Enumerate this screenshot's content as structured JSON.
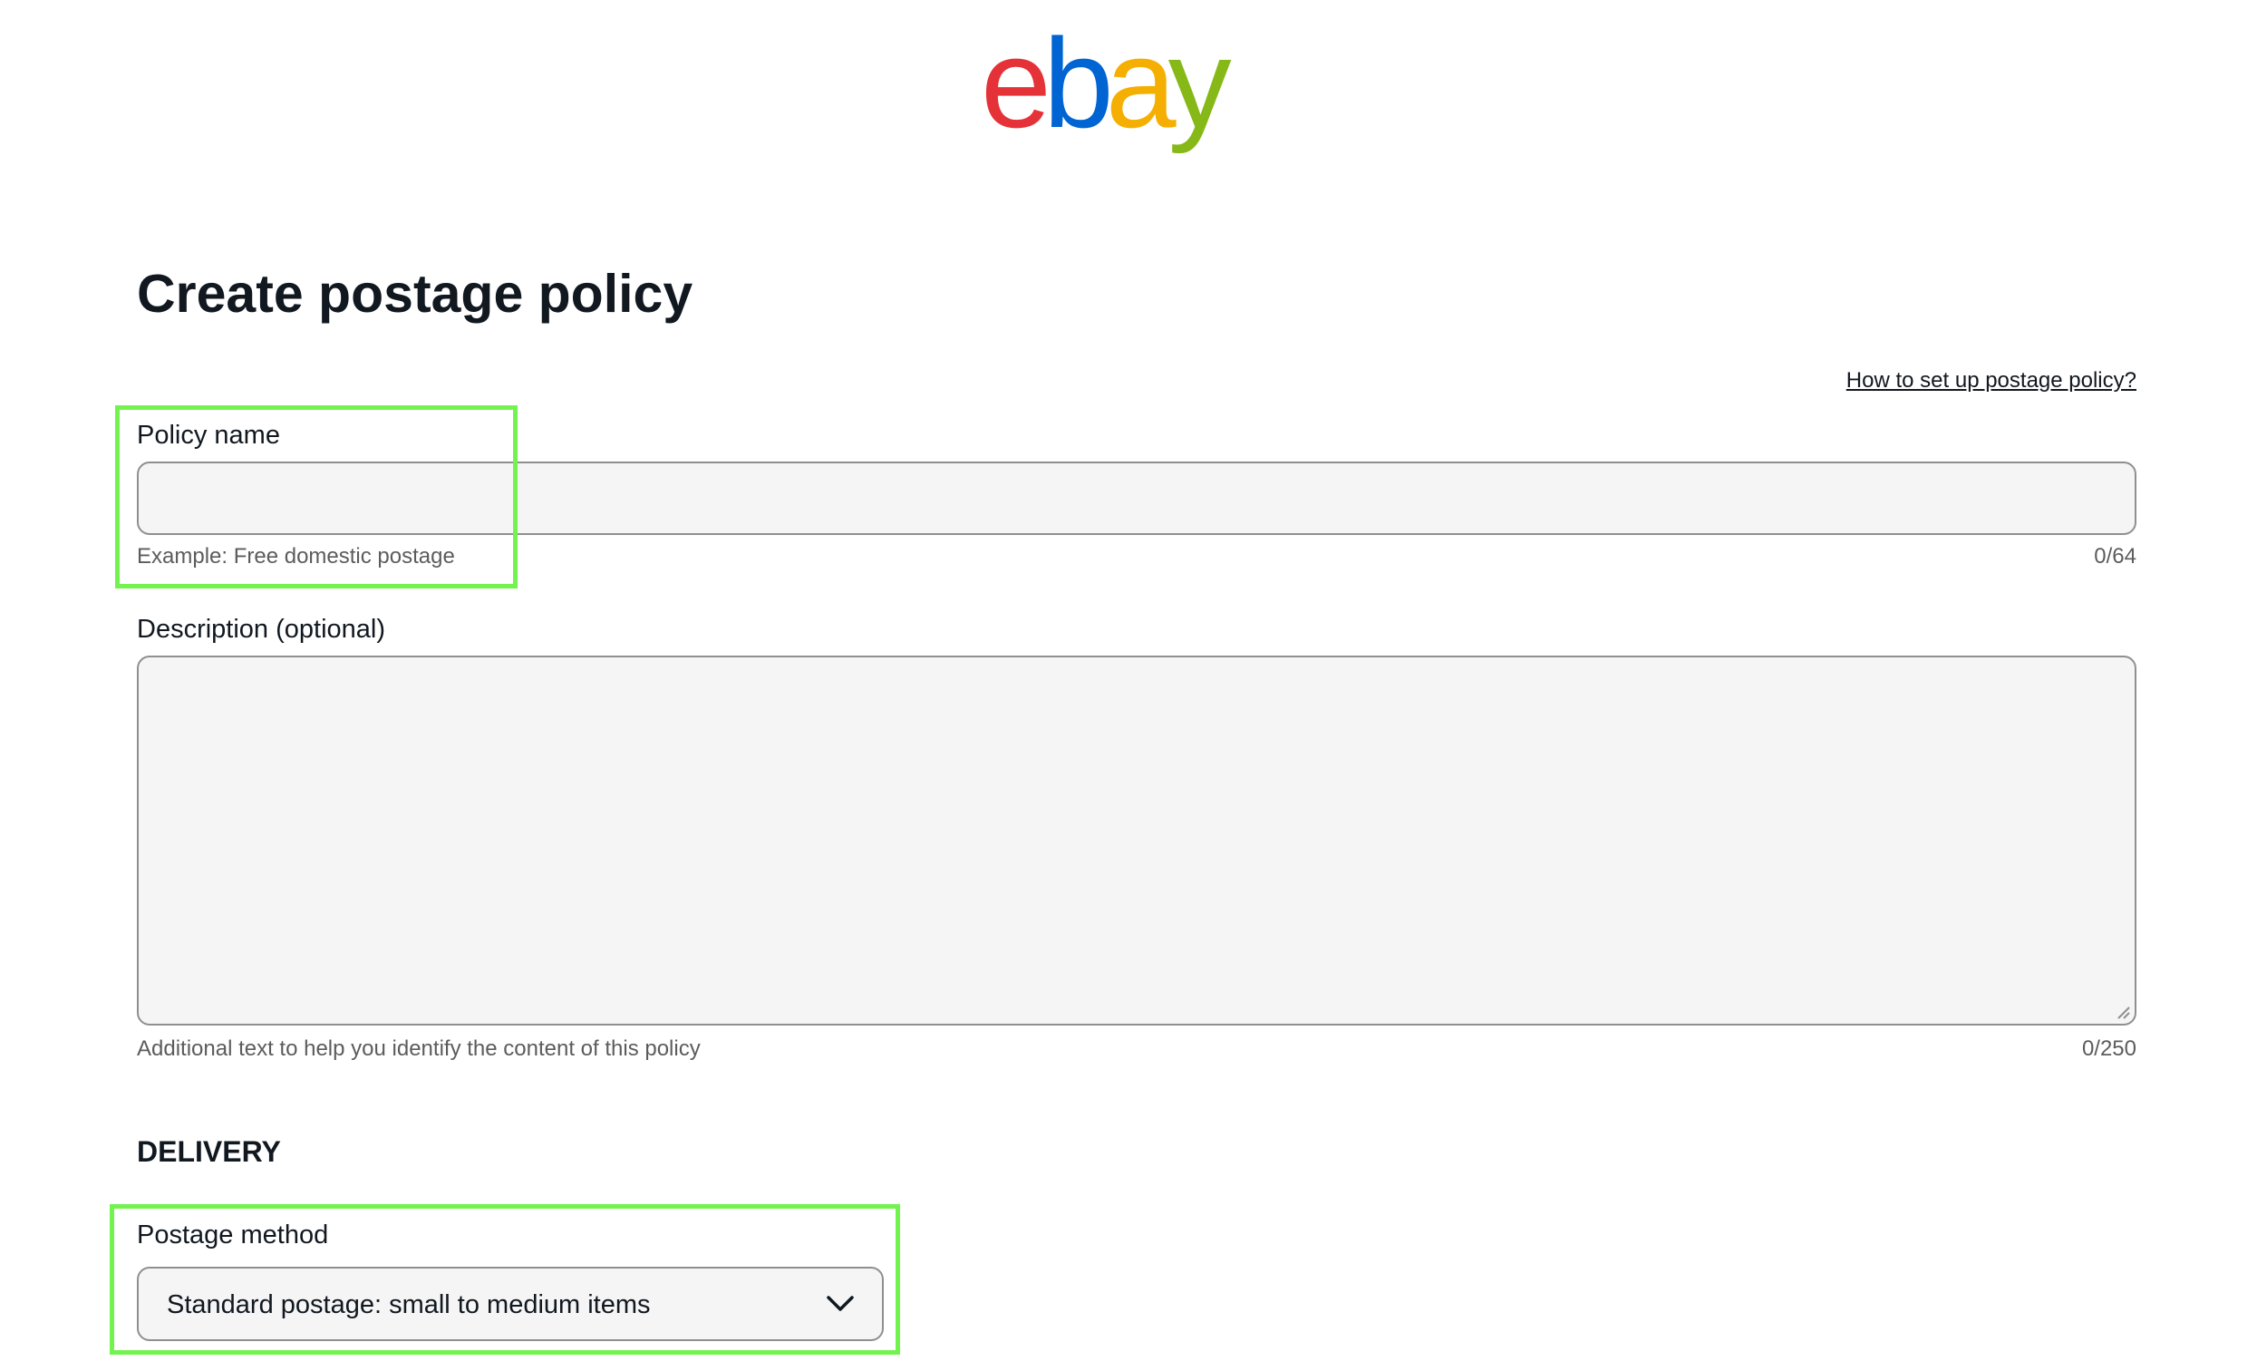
{
  "brand": {
    "logo_letters": [
      "e",
      "b",
      "a",
      "y"
    ],
    "logo_colors": [
      "#e53238",
      "#0064d2",
      "#f5af02",
      "#86b817"
    ]
  },
  "page": {
    "title": "Create postage policy",
    "help_link": "How to set up postage policy?"
  },
  "policy_name": {
    "label": "Policy name",
    "value": "",
    "helper": "Example: Free domestic postage",
    "counter": "0/64"
  },
  "description": {
    "label": "Description (optional)",
    "value": "",
    "helper": "Additional text to help you identify the content of this policy",
    "counter": "0/250"
  },
  "delivery": {
    "heading": "DELIVERY",
    "postage_method": {
      "label": "Postage method",
      "selected": "Standard postage: small to medium items",
      "icon": "chevron-down-icon"
    }
  },
  "colors": {
    "highlight": "#72f34e",
    "input_background": "#f5f5f5",
    "input_border": "#8f8f8f"
  }
}
